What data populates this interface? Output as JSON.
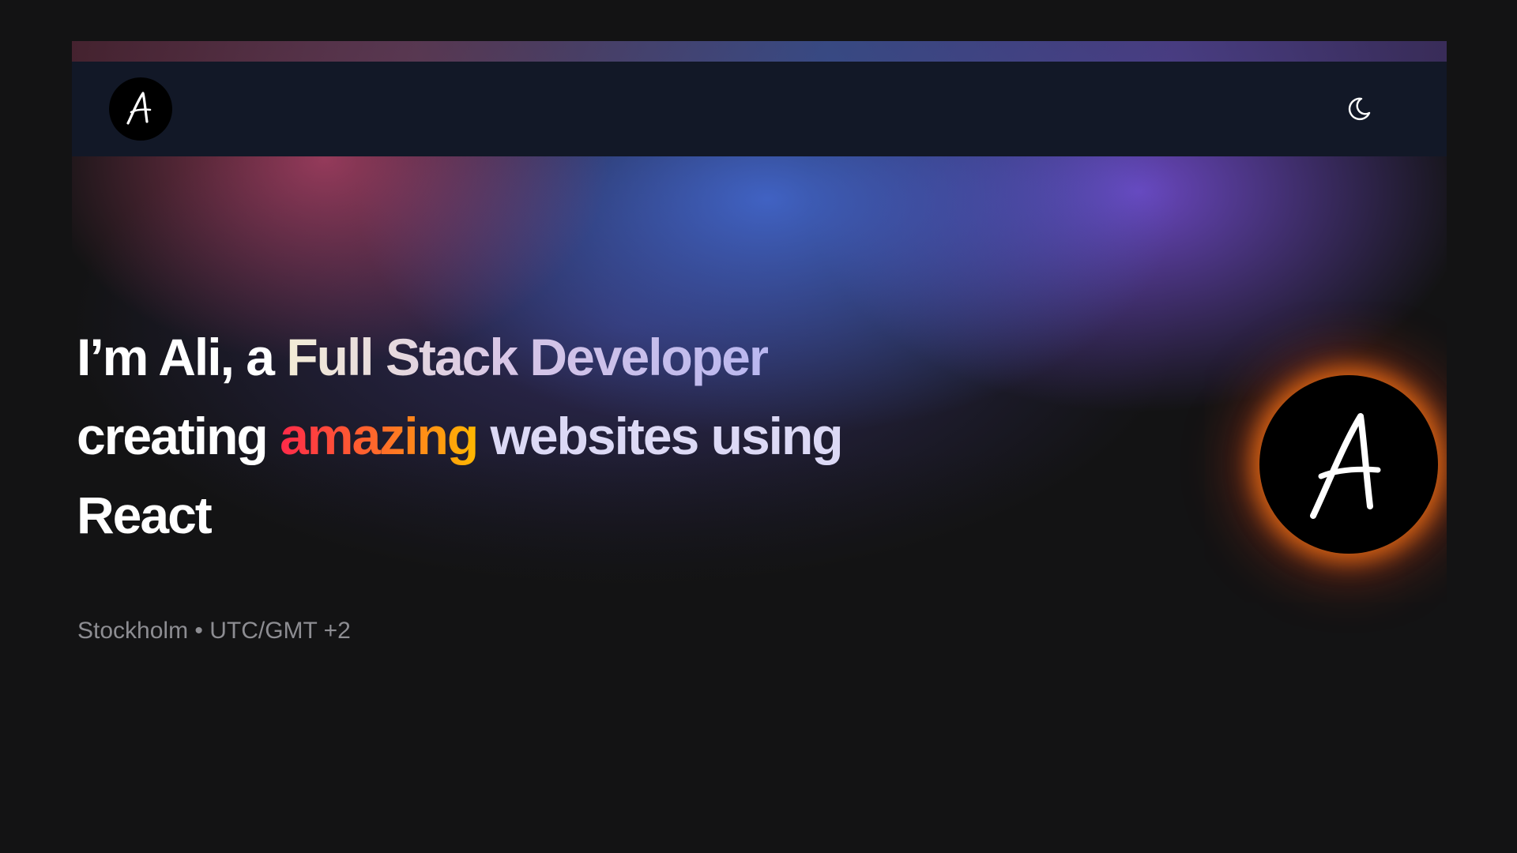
{
  "header": {
    "logo_icon": "signature-a-logo",
    "theme_toggle_icon": "moon-icon"
  },
  "hero": {
    "line1_prefix": "I’m Ali, a ",
    "role": "Full Stack Developer",
    "line2_prefix": "creating ",
    "highlight": "amazing",
    "line2_suffix": " websites using",
    "line3": "React",
    "location": "Stockholm • UTC/GMT +2",
    "avatar_icon": "signature-a-avatar"
  },
  "colors": {
    "background": "#131314",
    "navbar": "#121827",
    "highlight_start": "#ff2a4a",
    "highlight_end": "#ffb800",
    "glow": "#ff7814"
  }
}
